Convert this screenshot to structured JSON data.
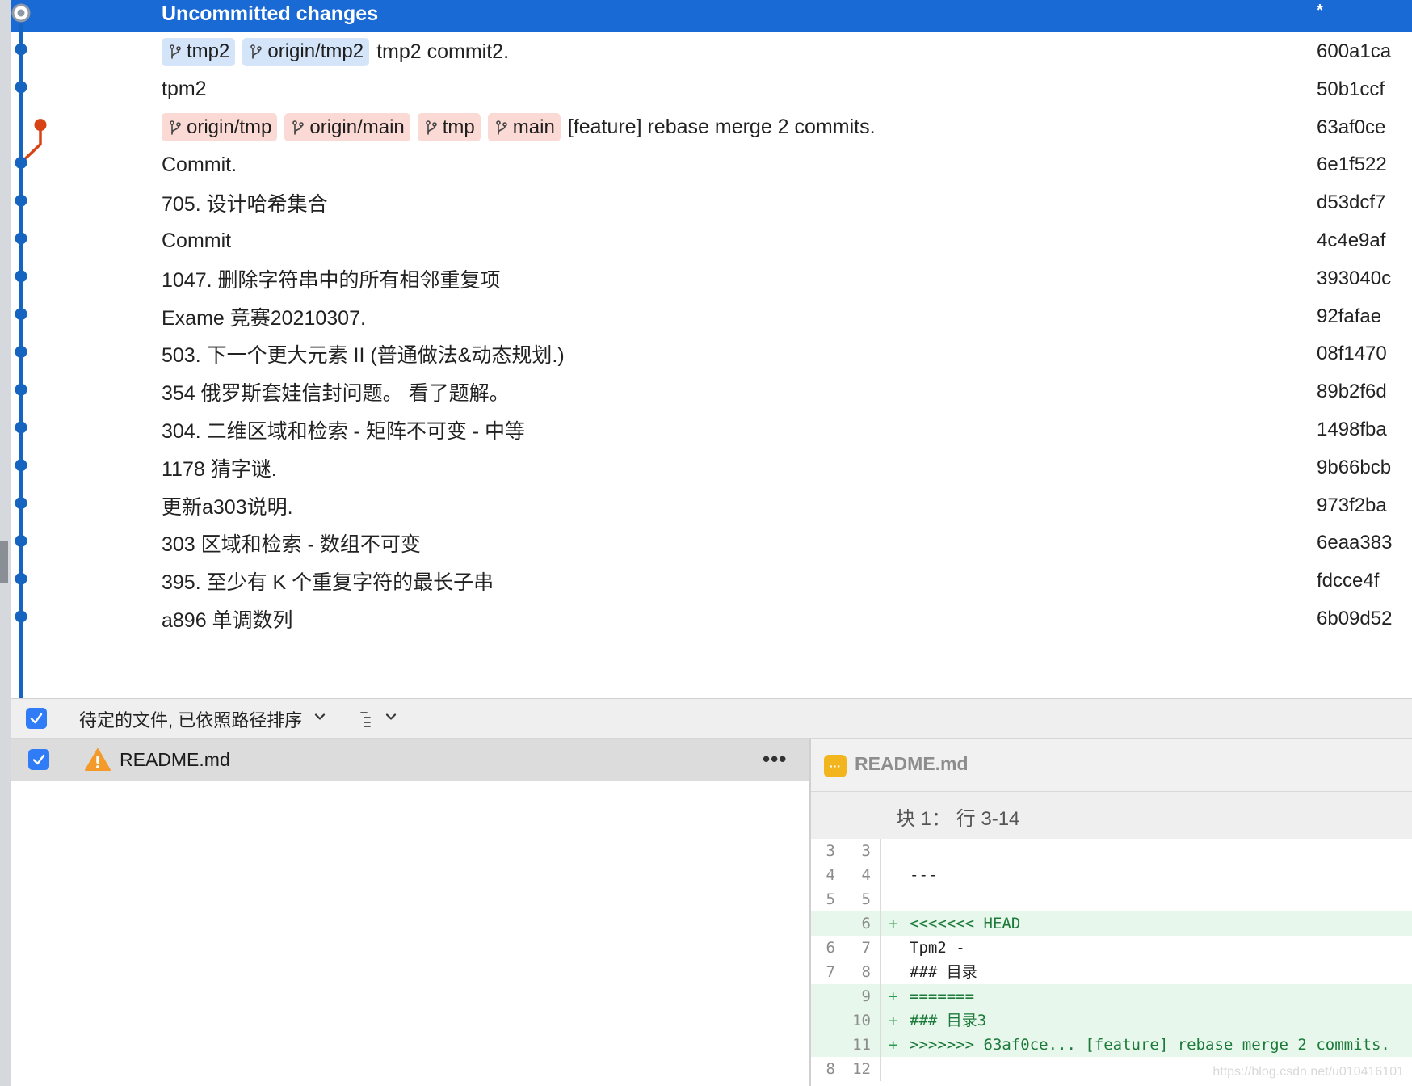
{
  "header": {
    "title": "Uncommitted changes",
    "star": "*"
  },
  "commits": [
    {
      "tags": [
        {
          "label": "tmp2",
          "color": "blue"
        },
        {
          "label": "origin/tmp2",
          "color": "blue"
        }
      ],
      "message": "tmp2 commit2.",
      "sha": "600a1ca"
    },
    {
      "tags": [],
      "message": "tpm2",
      "sha": "50b1ccf"
    },
    {
      "tags": [
        {
          "label": "origin/tmp",
          "color": "red"
        },
        {
          "label": "origin/main",
          "color": "red"
        },
        {
          "label": "tmp",
          "color": "red"
        },
        {
          "label": "main",
          "color": "red"
        }
      ],
      "message": "[feature] rebase merge 2 commits.",
      "sha": "63af0ce"
    },
    {
      "tags": [],
      "message": "Commit.",
      "sha": "6e1f522"
    },
    {
      "tags": [],
      "message": "705. 设计哈希集合",
      "sha": "d53dcf7"
    },
    {
      "tags": [],
      "message": "Commit",
      "sha": "4c4e9af"
    },
    {
      "tags": [],
      "message": "1047. 删除字符串中的所有相邻重复项",
      "sha": "393040c"
    },
    {
      "tags": [],
      "message": "Exame 竞赛20210307.",
      "sha": "92fafae"
    },
    {
      "tags": [],
      "message": "503. 下一个更大元素 II (普通做法&动态规划.)",
      "sha": "08f1470"
    },
    {
      "tags": [],
      "message": "354 俄罗斯套娃信封问题。 看了题解。",
      "sha": "89b2f6d"
    },
    {
      "tags": [],
      "message": " 304. 二维区域和检索 - 矩阵不可变 - 中等",
      "sha": "1498fba"
    },
    {
      "tags": [],
      "message": "1178 猜字谜.",
      "sha": "9b66bcb"
    },
    {
      "tags": [],
      "message": "更新a303说明.",
      "sha": "973f2ba"
    },
    {
      "tags": [],
      "message": "303 区域和检索 - 数组不可变",
      "sha": "6eaa383"
    },
    {
      "tags": [],
      "message": "395. 至少有 K 个重复字符的最长子串",
      "sha": "fdcce4f"
    },
    {
      "tags": [],
      "message": "a896 单调数列",
      "sha": "6b09d52"
    }
  ],
  "toolbar": {
    "label": "待定的文件, 已依照路径排序",
    "checked": true
  },
  "files": [
    {
      "name": "README.md",
      "status_icon": "warning-icon",
      "more_label": "•••",
      "checked": true
    }
  ],
  "diff": {
    "file_name": "README.md",
    "file_icon_label": "···",
    "hunk_label": "块 1： 行 3-14",
    "lines": [
      {
        "a": "3",
        "b": "3",
        "sign": "",
        "text": "",
        "added": false
      },
      {
        "a": "4",
        "b": "4",
        "sign": "",
        "text": "---",
        "added": false
      },
      {
        "a": "5",
        "b": "5",
        "sign": "",
        "text": "",
        "added": false
      },
      {
        "a": "",
        "b": "6",
        "sign": "+",
        "text": "<<<<<<< HEAD",
        "added": true
      },
      {
        "a": "6",
        "b": "7",
        "sign": "",
        "text": "Tpm2 -",
        "added": false
      },
      {
        "a": "7",
        "b": "8",
        "sign": "",
        "text": "### 目录",
        "added": false
      },
      {
        "a": "",
        "b": "9",
        "sign": "+",
        "text": "=======",
        "added": true
      },
      {
        "a": "",
        "b": "10",
        "sign": "+",
        "text": "### 目录3",
        "added": true
      },
      {
        "a": "",
        "b": "11",
        "sign": "+",
        "text": ">>>>>>> 63af0ce... [feature] rebase merge 2 commits.",
        "added": true
      },
      {
        "a": "8",
        "b": "12",
        "sign": "",
        "text": "",
        "added": false
      }
    ],
    "watermark": "https://blog.csdn.net/u010416101"
  },
  "colors": {
    "accent": "#1a6ad6",
    "graph_main": "#1565c0",
    "graph_branch": "#d84315",
    "tag_blue": "#d4e5fa",
    "tag_red": "#fbd9d4",
    "added_bg": "#e8f7ec"
  }
}
